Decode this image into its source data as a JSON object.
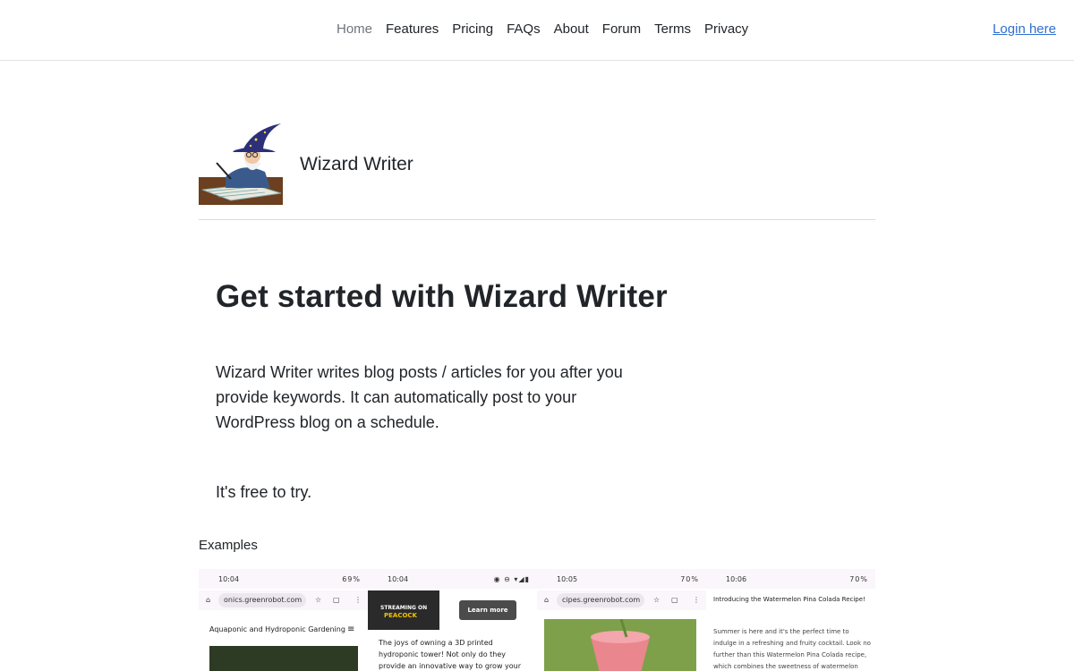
{
  "nav": {
    "items": [
      "Home",
      "Features",
      "Pricing",
      "FAQs",
      "About",
      "Forum",
      "Terms",
      "Privacy"
    ],
    "active": "Home",
    "login": "Login here"
  },
  "brand": {
    "name": "Wizard Writer"
  },
  "hero": {
    "title": "Get started with Wizard Writer",
    "description": "Wizard Writer writes blog posts / articles for you after you provide keywords. It can automatically post to your WordPress blog on a schedule.",
    "free": "It's free to try."
  },
  "examples": {
    "label": "Examples",
    "shots": [
      {
        "time": "10:04",
        "status": "69%",
        "url": "onics.greenrobot.com",
        "heading": "Aquaponic and Hydroponic Gardening"
      },
      {
        "time": "10:04",
        "ad_line1": "STREAMING ON",
        "ad_line2": "PEACOCK",
        "ad_button": "Learn more",
        "text": "The joys of owning a 3D printed hydroponic tower! Not only do they provide an innovative way to grow your favorite plants,"
      },
      {
        "time": "10:05",
        "status": "70%",
        "url": "cipes.greenrobot.com"
      },
      {
        "time": "10:06",
        "status": "70%",
        "heading": "Introducing the Watermelon Pina Colada Recipe!",
        "text": "Summer is here and it's the perfect time to indulge in a refreshing and fruity cocktail. Look no further than this Watermelon Pina Colada recipe, which combines the sweetness of watermelon with the"
      }
    ]
  },
  "colors": {
    "link": "#2f6fce",
    "text": "#212529",
    "muted": "#6c757d"
  }
}
